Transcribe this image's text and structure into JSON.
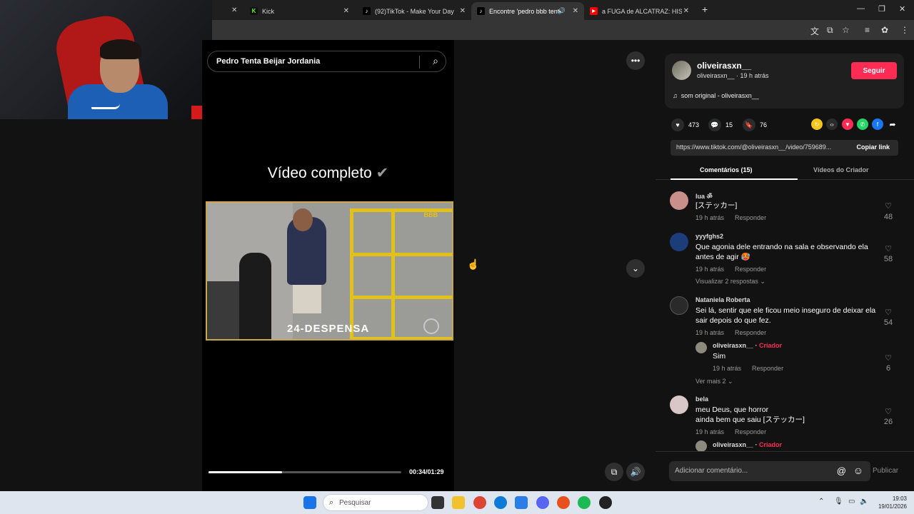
{
  "browser": {
    "tabs": [
      {
        "title": "Kick",
        "icon": "kick-icon",
        "color": "#53fc18"
      },
      {
        "title": "(92)TikTok - Make Your Day",
        "icon": "tiktok-icon",
        "color": "#ffffff"
      },
      {
        "title": "Encontre 'pedro bbb tentou",
        "icon": "tiktok-icon",
        "color": "#ffffff",
        "active": true,
        "audio": true
      },
      {
        "title": "a FUGA de ALCATRAZ: HISTÓRI",
        "icon": "youtube-icon",
        "color": "#ff0000"
      }
    ],
    "new_tab_label": "+"
  },
  "search": {
    "query": "Pedro Tenta Beijar Jordania"
  },
  "video": {
    "title": "Vídeo completo",
    "title_mark": "✔",
    "clip_caption": "24-DESPENSA",
    "clip_logo": "BBB",
    "time": "00:34/01:29",
    "progress": 0.38
  },
  "author": {
    "name": "oliveirasxn__",
    "subline": "oliveirasxn__ · 19 h atrás",
    "follow_label": "Seguir",
    "music": "som original - oliveirasxn__"
  },
  "stats": {
    "likes": "473",
    "comments": "15",
    "saves": "76"
  },
  "link": {
    "url": "https://www.tiktok.com/@oliveirasxn__/video/759689...",
    "copy_label": "Copiar link"
  },
  "tabs": {
    "comments": "Comentários (15)",
    "creator_videos": "Vídeos do Criador"
  },
  "comments": [
    {
      "user": "lua ॐ",
      "text": "[ステッカー]",
      "time": "19 h atrás",
      "reply": "Responder",
      "likes": "48",
      "avatar_color": "#c98f8a"
    },
    {
      "user": "yyyfghs2",
      "text": "Que agonia dele entrando na sala e observando ela antes de agir 🥵",
      "time": "19 h atrás",
      "reply": "Responder",
      "likes": "58",
      "more": "Visualizar 2 respostas",
      "avatar_color": "#1d3d7a"
    },
    {
      "user": "Nataniela Roberta",
      "text": "Sei lá, sentir que ele ficou meio inseguro de deixar ela sair depois do que fez.",
      "time": "19 h atrás",
      "reply": "Responder",
      "likes": "54",
      "avatar_color": "#2a2a2a"
    },
    {
      "user": "bela",
      "text": "meu Deus, que horror\nainda bem que saiu [ステッカー]",
      "time": "19 h atrás",
      "reply": "Responder",
      "likes": "26",
      "avatar_color": "#d9c7c7"
    }
  ],
  "replies": [
    {
      "user": "oliveirasxn__",
      "badge": "Criador",
      "sep": " · ",
      "text": "Sim",
      "time": "19 h atrás",
      "reply": "Responder",
      "likes": "6",
      "more": "Ver mais 2"
    },
    {
      "user": "oliveirasxn__",
      "badge": "Criador",
      "sep": " · "
    }
  ],
  "comment_input": {
    "placeholder": "Adicionar comentário...",
    "publish": "Publicar"
  },
  "taskbar": {
    "search_label": "Pesquisar",
    "time": "19:03",
    "date": "19/01/2026"
  }
}
